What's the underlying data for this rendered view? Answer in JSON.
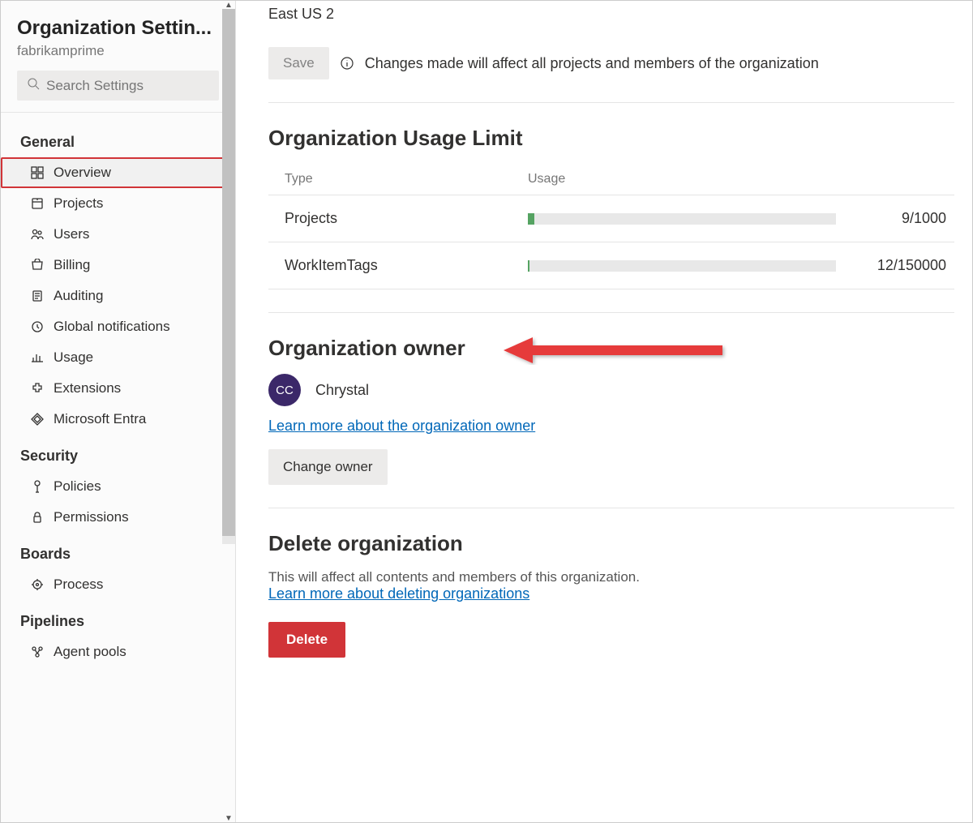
{
  "sidebar": {
    "title": "Organization Settin...",
    "subtitle": "fabrikamprime",
    "search_placeholder": "Search Settings",
    "sections": {
      "general": {
        "label": "General",
        "items": [
          "Overview",
          "Projects",
          "Users",
          "Billing",
          "Auditing",
          "Global notifications",
          "Usage",
          "Extensions",
          "Microsoft Entra"
        ]
      },
      "security": {
        "label": "Security",
        "items": [
          "Policies",
          "Permissions"
        ]
      },
      "boards": {
        "label": "Boards",
        "items": [
          "Process"
        ]
      },
      "pipelines": {
        "label": "Pipelines",
        "items": [
          "Agent pools"
        ]
      }
    }
  },
  "main": {
    "region": "East US 2",
    "save_label": "Save",
    "save_info": "Changes made will affect all projects and members of the organization",
    "usage": {
      "heading": "Organization Usage Limit",
      "col_type": "Type",
      "col_usage": "Usage",
      "rows": [
        {
          "type": "Projects",
          "value": "9/1000",
          "pct": 0.9
        },
        {
          "type": "WorkItemTags",
          "value": "12/150000",
          "pct": 0.008
        }
      ]
    },
    "owner": {
      "heading": "Organization owner",
      "initials": "CC",
      "name": "Chrystal",
      "learn_link": "Learn more about the organization owner",
      "change_btn": "Change owner"
    },
    "delete_org": {
      "heading": "Delete organization",
      "desc": "This will affect all contents and members of this organization.",
      "learn_link": "Learn more about deleting organizations",
      "btn": "Delete"
    }
  }
}
